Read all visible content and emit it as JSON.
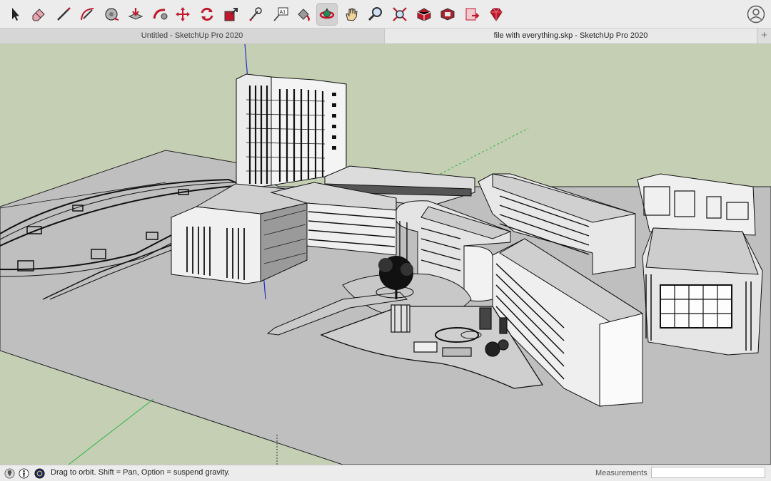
{
  "toolbar": {
    "tools": [
      {
        "name": "select-tool-icon"
      },
      {
        "name": "eraser-tool-icon"
      },
      {
        "name": "line-tool-icon"
      },
      {
        "name": "arc-tool-icon"
      },
      {
        "name": "tape-measure-tool-icon"
      },
      {
        "name": "push-pull-tool-icon"
      },
      {
        "name": "follow-me-tool-icon"
      },
      {
        "name": "move-tool-icon"
      },
      {
        "name": "rotate-tool-icon"
      },
      {
        "name": "scale-tool-icon"
      },
      {
        "name": "measure-tool-icon"
      },
      {
        "name": "text-tool-icon",
        "label": "A1"
      },
      {
        "name": "paint-bucket-tool-icon"
      },
      {
        "name": "orbit-tool-icon",
        "active": true
      },
      {
        "name": "pan-tool-icon"
      },
      {
        "name": "zoom-tool-icon"
      },
      {
        "name": "zoom-extents-tool-icon"
      },
      {
        "name": "warehouse-icon"
      },
      {
        "name": "extension-warehouse-icon"
      },
      {
        "name": "layout-send-icon"
      },
      {
        "name": "ruby-console-icon"
      }
    ],
    "account_icon": "account-icon"
  },
  "tabs": [
    {
      "label": "Untitled - SketchUp Pro 2020"
    },
    {
      "label": "file with everything.skp - SketchUp Pro 2020"
    }
  ],
  "tab_add_label": "+",
  "status": {
    "text": "Drag to orbit. Shift = Pan, Option = suspend gravity.",
    "measurements_label": "Measurements",
    "measurements_value": ""
  },
  "colors": {
    "sky": "#c5cfb4",
    "ground": "#c0c0c0",
    "tool_red": "#c0172b",
    "axis_blue": "#1f2fd0",
    "axis_green": "#2db34a"
  }
}
